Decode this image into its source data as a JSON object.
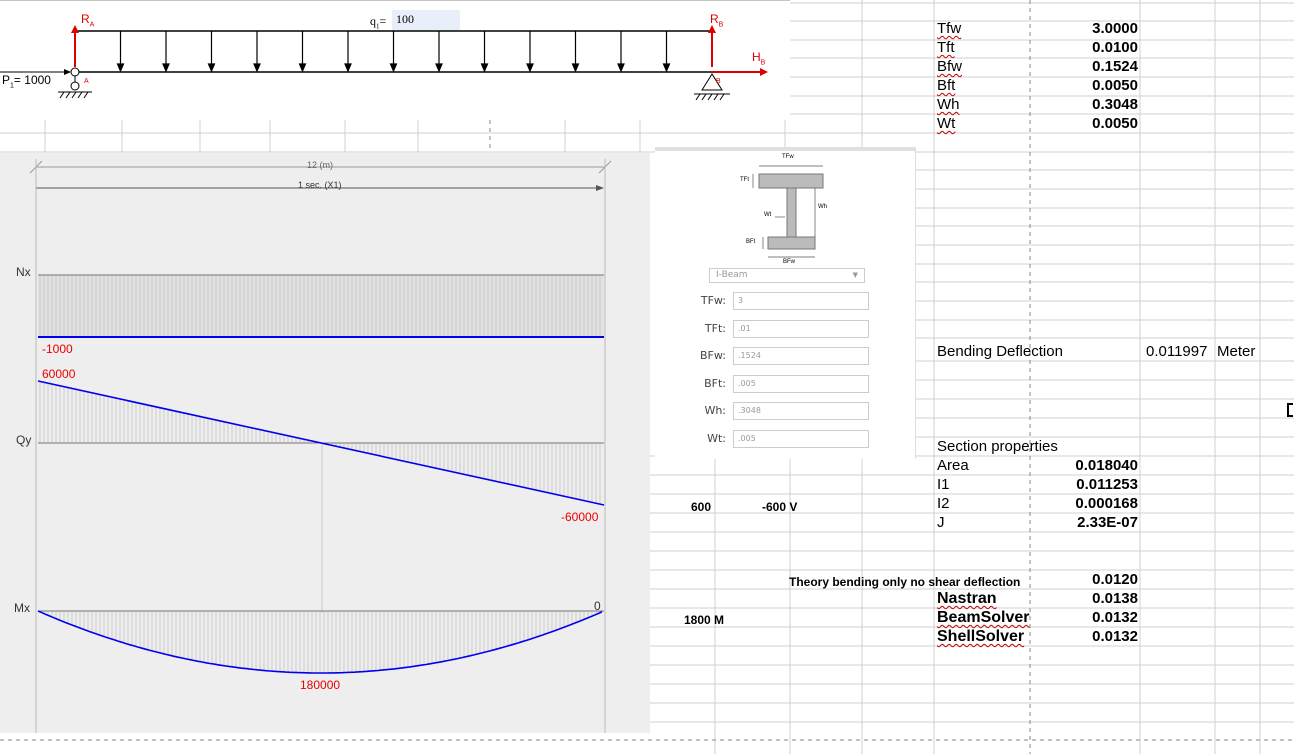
{
  "beam": {
    "ra_label": "R",
    "ra_sub": "A",
    "rb_label": "R",
    "rb_sub": "B",
    "hb_label": "H",
    "hb_sub": "B",
    "q_label": "q",
    "q_sub": "1",
    "q_value": "100",
    "p_label": "P",
    "p_sub": "1",
    "p_value": "= 1000",
    "support_a": "A",
    "support_b": "B"
  },
  "diagram": {
    "length_label": "12 (m)",
    "section_label": "1 sec. (X1)",
    "nx_label": "Nx",
    "qy_label": "Qy",
    "mx_label": "Mx",
    "nx_value": "-1000",
    "qy_start": "60000",
    "qy_end": "-60000",
    "mx_end": "0",
    "mx_mid": "180000"
  },
  "section_form": {
    "fig_tfw": "TFw",
    "fig_tft": "TFt",
    "fig_wt": "Wt",
    "fig_wh": "Wh",
    "fig_bft": "BFt",
    "fig_bfw": "BFw",
    "select_value": "I-Beam",
    "fields": [
      {
        "label": "TFw:",
        "value": "3"
      },
      {
        "label": "TFt:",
        "value": ".01"
      },
      {
        "label": "BFw:",
        "value": ".1524"
      },
      {
        "label": "BFt:",
        "value": ".005"
      },
      {
        "label": "Wh:",
        "value": ".3048"
      },
      {
        "label": "Wt:",
        "value": ".005"
      }
    ]
  },
  "params": [
    {
      "name": "Tfw",
      "value": "3.0000"
    },
    {
      "name": "Tft",
      "value": "0.0100"
    },
    {
      "name": "Bfw",
      "value": "0.1524"
    },
    {
      "name": "Bft",
      "value": "0.0050"
    },
    {
      "name": "Wh",
      "value": "0.3048"
    },
    {
      "name": "Wt",
      "value": "0.0050"
    }
  ],
  "bending": {
    "label": "Bending Deflection",
    "value": "0.011997",
    "unit": "Meter"
  },
  "section_props": {
    "title": "Section properties",
    "rows": [
      {
        "name": "Area",
        "value": "0.018040"
      },
      {
        "name": "I1",
        "value": "0.011253"
      },
      {
        "name": "I2",
        "value": "0.000168"
      },
      {
        "name": "J",
        "value": "2.33E-07"
      }
    ]
  },
  "shear": {
    "left": "600",
    "right": "-600 V"
  },
  "moment": {
    "label": "1800 M"
  },
  "theory": {
    "label": "Theory bending only no shear deflection",
    "value": "0.0120"
  },
  "solvers": [
    {
      "name": "Nastran",
      "value": "0.0138"
    },
    {
      "name": "BeamSolver",
      "value": "0.0132"
    },
    {
      "name": "ShellSolver",
      "value": "0.0132"
    }
  ],
  "colors": {
    "reaction": "#dd0000",
    "diagram_line": "#0000ee",
    "diagram_value": "#ee0000",
    "grid": "#c8c8c8",
    "panel_bg": "#eeeeee"
  }
}
